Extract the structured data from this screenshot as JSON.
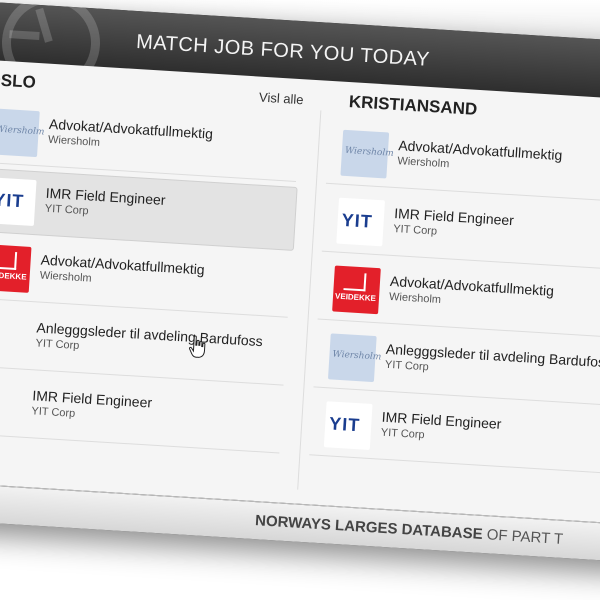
{
  "header": {
    "title": "MATCH JOB FOR YOU TODAY"
  },
  "columns": [
    {
      "title": "OSLO",
      "see_all": "Visl alle",
      "jobs": [
        {
          "title": "Advokat/Advokatfullmektig",
          "company": "Wiersholm",
          "logo": "wiersholm-logo"
        },
        {
          "title": "IMR Field Engineer",
          "company": "YIT Corp",
          "logo": "yit-logo"
        },
        {
          "title": "Advokat/Advokatfullmektig",
          "company": "Wiersholm",
          "logo": "veidekke-logo"
        },
        {
          "title": "Anlegggsleder til avdeling Bardufoss",
          "company": "YIT Corp",
          "logo": "none"
        },
        {
          "title": "IMR Field Engineer",
          "company": "YIT Corp",
          "logo": "none"
        }
      ]
    },
    {
      "title": "KRISTIANSAND",
      "jobs": [
        {
          "title": "Advokat/Advokatfullmektig",
          "company": "Wiersholm",
          "logo": "wiersholm-logo"
        },
        {
          "title": "IMR Field Engineer",
          "company": "YIT Corp",
          "logo": "yit-logo"
        },
        {
          "title": "Advokat/Advokatfullmektig",
          "company": "Wiersholm",
          "logo": "veidekke-logo"
        },
        {
          "title": "Anlegggsleder til avdeling Bardufoss",
          "company": "YIT Corp",
          "logo": "wiersholm-logo"
        },
        {
          "title": "IMR Field Engineer",
          "company": "YIT Corp",
          "logo": "yit-logo"
        }
      ]
    }
  ],
  "logos": {
    "yit": "YIT",
    "veidekke": "VEIDEKKE",
    "wiersholm": "Wiersholm"
  },
  "footer": {
    "bold": "NORWAYS LARGES DATABASE",
    "rest": " OF PART T"
  },
  "colors": {
    "header": "#3a3a3a",
    "veidekke": "#e3202a",
    "yit": "#1a3d8f",
    "wiersholm": "#c9d7ea"
  }
}
